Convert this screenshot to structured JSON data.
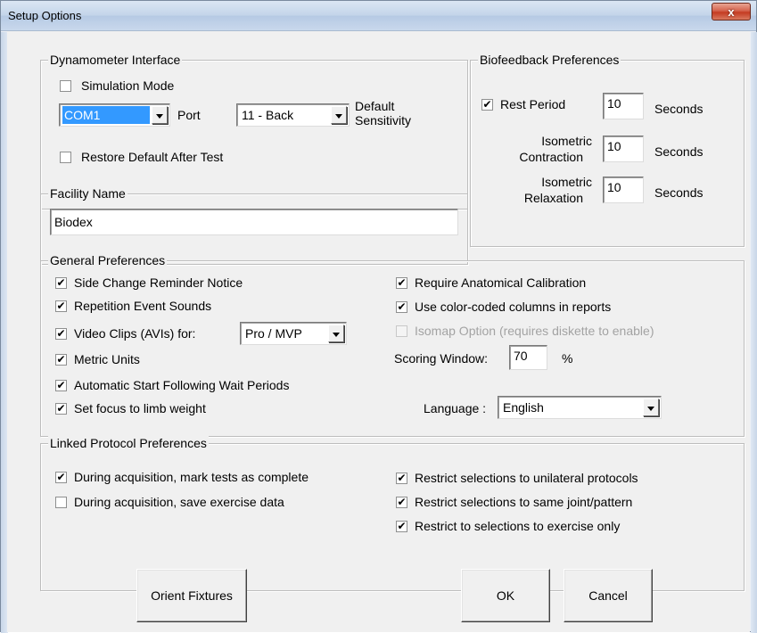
{
  "window": {
    "title": "Setup Options",
    "close_glyph": "x"
  },
  "dynamometer": {
    "legend": "Dynamometer Interface",
    "simulation_mode": {
      "label": "Simulation Mode",
      "checked": false
    },
    "port_value": "COM1",
    "port_label": "Port",
    "sensitivity_value": "11 - Back",
    "sensitivity_label_1": "Default",
    "sensitivity_label_2": "Sensitivity",
    "restore_default": {
      "label": "Restore Default After Test",
      "checked": false
    }
  },
  "biofeedback": {
    "legend": "Biofeedback Preferences",
    "rest_period": {
      "label": "Rest Period",
      "checked": true,
      "value": "10",
      "unit": "Seconds"
    },
    "isometric_contraction": {
      "label_1": "Isometric",
      "label_2": "Contraction",
      "value": "10",
      "unit": "Seconds"
    },
    "isometric_relaxation": {
      "label_1": "Isometric",
      "label_2": "Relaxation",
      "value": "10",
      "unit": "Seconds"
    }
  },
  "facility": {
    "legend": "Facility Name",
    "value": "Biodex"
  },
  "general": {
    "legend": "General Preferences",
    "side_change": {
      "label": "Side Change Reminder Notice",
      "checked": true
    },
    "repetition_sounds": {
      "label": "Repetition Event Sounds",
      "checked": true
    },
    "video_clips": {
      "label": "Video Clips (AVIs) for:",
      "checked": true,
      "select_value": "Pro / MVP"
    },
    "metric_units": {
      "label": "Metric Units",
      "checked": true
    },
    "auto_start": {
      "label": "Automatic Start Following Wait Periods",
      "checked": true
    },
    "set_focus": {
      "label": "Set focus to limb weight",
      "checked": true
    },
    "require_calibration": {
      "label": "Require Anatomical Calibration",
      "checked": true
    },
    "color_coded": {
      "label": "Use color-coded columns in reports",
      "checked": true
    },
    "isomap_option": {
      "label": "Isomap Option (requires diskette to enable)",
      "checked": false,
      "disabled": true
    },
    "scoring_window": {
      "label": "Scoring Window:",
      "value": "70",
      "unit": "%"
    },
    "language": {
      "label": "Language :",
      "value": "English"
    }
  },
  "linked": {
    "legend": "Linked Protocol Preferences",
    "mark_complete": {
      "label": "During acquisition, mark tests as complete",
      "checked": true
    },
    "save_exercise": {
      "label": "During acquisition, save exercise data",
      "checked": false
    },
    "restrict_unilateral": {
      "label": "Restrict selections to unilateral protocols",
      "checked": true
    },
    "restrict_joint": {
      "label": "Restrict selections to same joint/pattern",
      "checked": true
    },
    "restrict_exercise": {
      "label": "Restrict to selections to exercise only",
      "checked": true
    }
  },
  "buttons": {
    "orient_fixtures": "Orient Fixtures",
    "ok": "OK",
    "cancel": "Cancel"
  },
  "check_glyph": "✔"
}
